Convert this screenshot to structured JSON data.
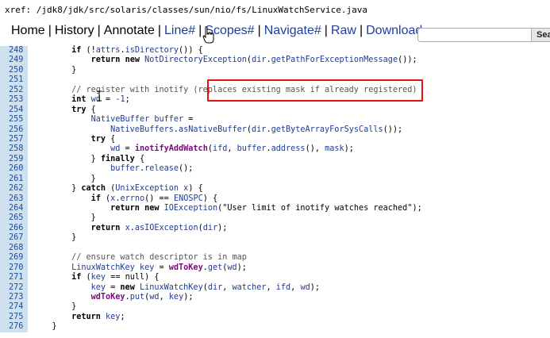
{
  "xref": {
    "prefix": "xref: ",
    "path": "/jdk8/jdk/src/solaris/classes/sun/nio/fs/LinuxWatchService.java"
  },
  "nav": {
    "items": [
      {
        "label": "Home",
        "color": "#000000"
      },
      {
        "label": "History",
        "color": "#000000"
      },
      {
        "label": "Annotate",
        "color": "#000000"
      },
      {
        "label": "Line#",
        "color": "#1e3d99"
      },
      {
        "label": "Scopes#",
        "color": "#1e3d99"
      },
      {
        "label": "Navigate#",
        "color": "#1e3d99"
      },
      {
        "label": "Raw",
        "color": "#1e3d99"
      },
      {
        "label": "Download",
        "color": "#1e3d99"
      }
    ],
    "separator": "|",
    "search_button_label": "Sea",
    "search_value": ""
  },
  "code": {
    "lines": [
      {
        "n": "248",
        "text": "        if (!attrs.isDirectory()) {"
      },
      {
        "n": "249",
        "text": "            return new NotDirectoryException(dir.getPathForExceptionMessage());"
      },
      {
        "n": "250",
        "text": "        }"
      },
      {
        "n": "251",
        "text": ""
      },
      {
        "n": "252",
        "text": "        // register with inotify (replaces existing mask if already registered)"
      },
      {
        "n": "253",
        "text": "        int wd = -1;"
      },
      {
        "n": "254",
        "text": "        try {"
      },
      {
        "n": "255",
        "text": "            NativeBuffer buffer ="
      },
      {
        "n": "256",
        "text": "                NativeBuffers.asNativeBuffer(dir.getByteArrayForSysCalls());"
      },
      {
        "n": "257",
        "text": "            try {"
      },
      {
        "n": "258",
        "text": "                wd = inotifyAddWatch(ifd, buffer.address(), mask);"
      },
      {
        "n": "259",
        "text": "            } finally {"
      },
      {
        "n": "260",
        "text": "                buffer.release();"
      },
      {
        "n": "261",
        "text": "            }"
      },
      {
        "n": "262",
        "text": "        } catch (UnixException x) {"
      },
      {
        "n": "263",
        "text": "            if (x.errno() == ENOSPC) {"
      },
      {
        "n": "264",
        "text": "                return new IOException(\"User limit of inotify watches reached\");"
      },
      {
        "n": "265",
        "text": "            }"
      },
      {
        "n": "266",
        "text": "            return x.asIOException(dir);"
      },
      {
        "n": "267",
        "text": "        }"
      },
      {
        "n": "268",
        "text": ""
      },
      {
        "n": "269",
        "text": "        // ensure watch descriptor is in map"
      },
      {
        "n": "270",
        "text": "        LinuxWatchKey key = wdToKey.get(wd);"
      },
      {
        "n": "271",
        "text": "        if (key == null) {"
      },
      {
        "n": "272",
        "text": "            key = new LinuxWatchKey(dir, watcher, ifd, wd);"
      },
      {
        "n": "273",
        "text": "            wdToKey.put(wd, key);"
      },
      {
        "n": "274",
        "text": "        }"
      },
      {
        "n": "275",
        "text": "        return key;"
      },
      {
        "n": "276",
        "text": "    }"
      }
    ]
  },
  "colors": {
    "link": "#1e3d99",
    "line_number_bg": "#cfe0ef",
    "highlight_border": "#e11111"
  }
}
